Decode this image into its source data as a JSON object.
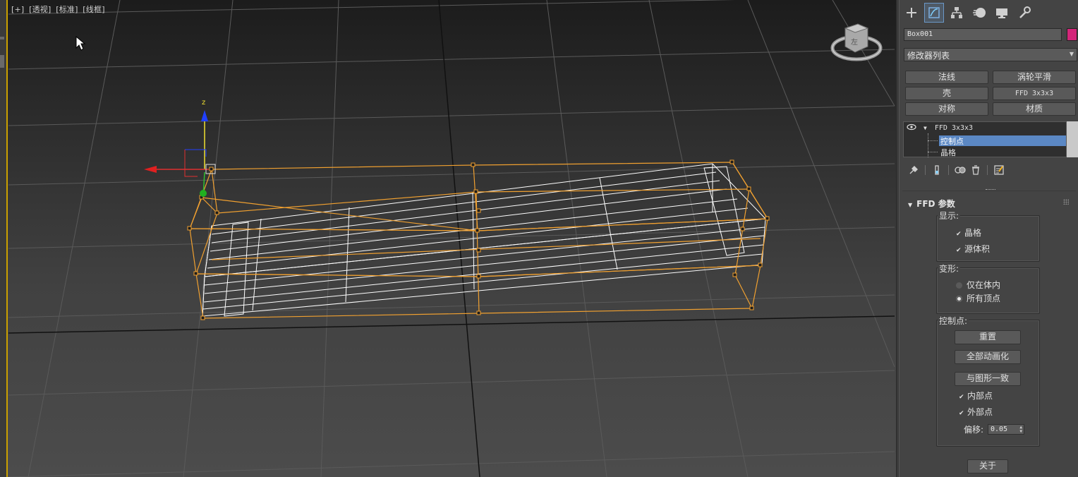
{
  "viewport": {
    "labels": [
      "[+]",
      "[透视]",
      "[标准]",
      "[线框]"
    ],
    "axis_z": "z",
    "viewcube_face": "左"
  },
  "panel": {
    "tabs": [
      {
        "icon": "create-plus-icon"
      },
      {
        "icon": "modify-icon"
      },
      {
        "icon": "hierarchy-icon"
      },
      {
        "icon": "motion-icon"
      },
      {
        "icon": "display-icon"
      },
      {
        "icon": "utilities-wrench-icon"
      }
    ],
    "object_name": "Box001",
    "object_color": "#d4267a",
    "modifier_list": "修改器列表",
    "quick_buttons": [
      "法线",
      "涡轮平滑",
      "壳",
      "FFD 3x3x3",
      "对称",
      "材质"
    ],
    "stack": {
      "modifier": "FFD 3x3x3",
      "sub_selected": "控制点",
      "sub_other": "晶格"
    },
    "rollout": {
      "title": "FFD 参数",
      "display_group": "显示:",
      "lattice": "晶格",
      "source_volume": "源体积",
      "deform_group": "变形:",
      "only_in_volume": "仅在体内",
      "all_vertices": "所有顶点",
      "control_points_group": "控制点:",
      "reset": "重置",
      "animate_all": "全部动画化",
      "conform_to_shape": "与图形一致",
      "inside_points": "内部点",
      "outside_points": "外部点",
      "offset_label": "偏移:",
      "offset_value": "0.05",
      "about": "关于"
    }
  },
  "colors": {
    "lattice": "#f0a030",
    "wireframe": "#ffffff",
    "selection_highlight": "#5b88c4"
  }
}
